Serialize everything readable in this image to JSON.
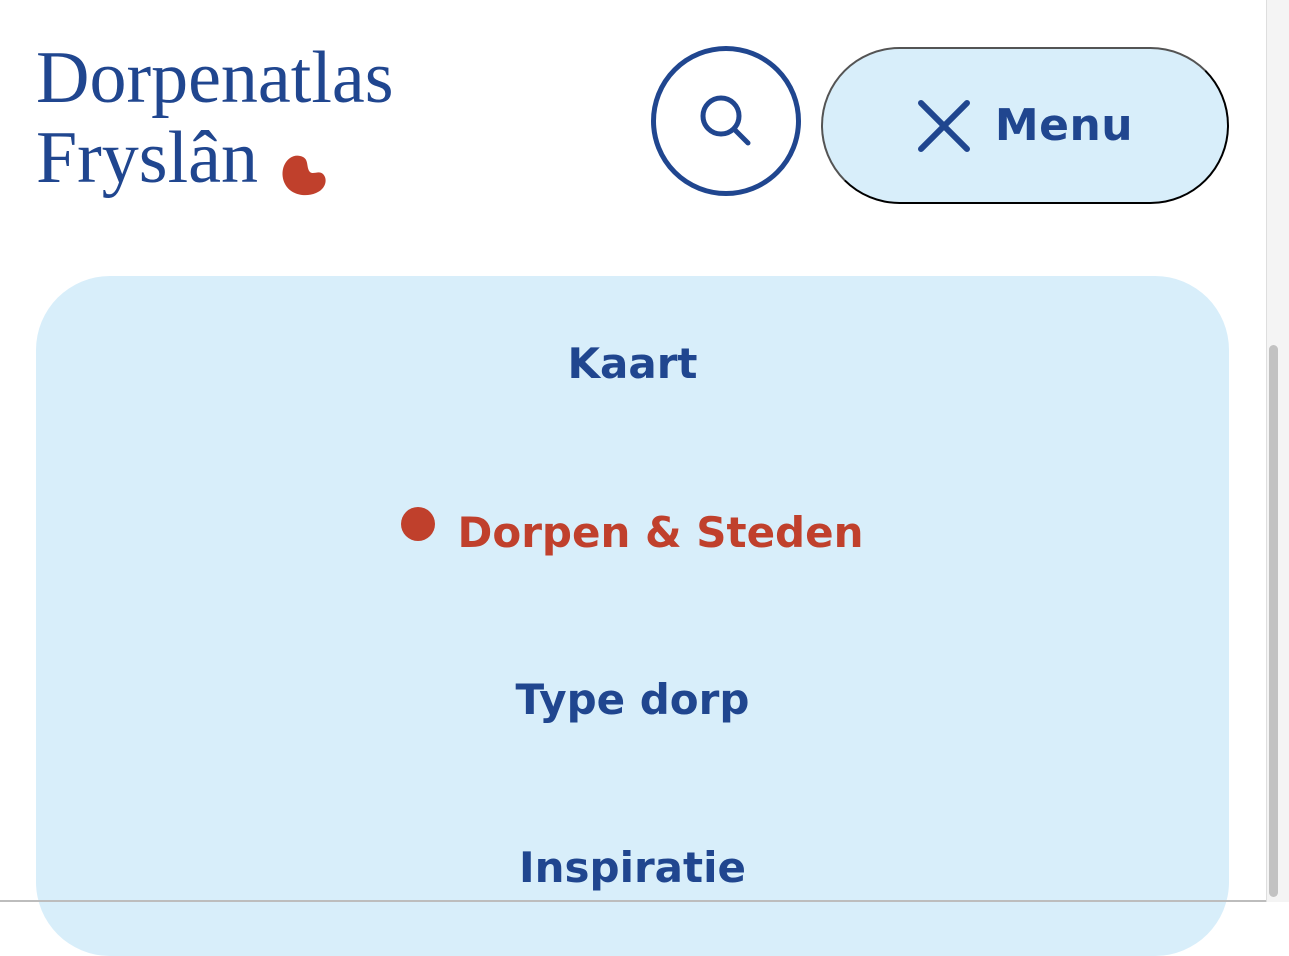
{
  "header": {
    "logo_line1": "Dorpenatlas",
    "logo_line2": "Fryslân",
    "menu_label": "Menu"
  },
  "icons": {
    "search": "search-icon",
    "close": "close-icon",
    "logo_mark": "red-blob-logo-mark",
    "active_indicator": "red-dot"
  },
  "nav": {
    "items": [
      {
        "label": "Kaart"
      },
      {
        "label": "Dorpen & Steden"
      },
      {
        "label": "Type dorp"
      },
      {
        "label": "Inspiratie"
      }
    ],
    "active_index": 1
  },
  "colors": {
    "brand_blue": "#20468f",
    "accent_red": "#c0402c",
    "panel_bg": "#d8eefa",
    "page_bg": "#ffffff"
  }
}
